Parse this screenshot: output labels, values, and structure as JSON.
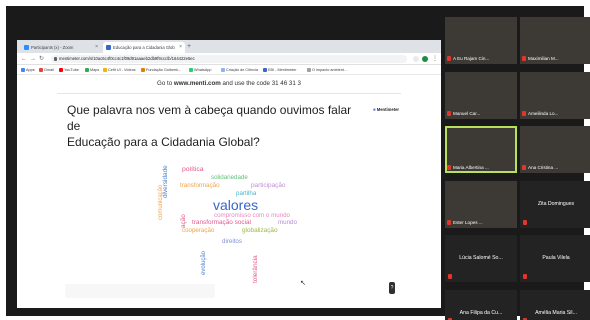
{
  "browser": {
    "tabs": [
      {
        "label": "Participants (x) - Zoom"
      },
      {
        "label": "Educação para a Cidadania Glob"
      }
    ],
    "url": "mentimeter.com/s/10ac6c4f0cc4c1f09d91aaaeb2db9f9ccc/b/164422e5ec",
    "bookmarks": [
      "Apps",
      "Gmail",
      "YouTube",
      "Maps",
      "Cefit UI - Videos",
      "Fundação Gulbenk...",
      "WhatsApp",
      "Criação de Ciência",
      "EBI - Mentimeter",
      "O impacto ambient..."
    ]
  },
  "menti": {
    "goto_prefix": "Go to ",
    "goto_site": "www.menti.com",
    "goto_suffix": " and use the code 31 46 31 3",
    "question_line1": "Que palavra nos vem à cabeça quando ouvimos falar de",
    "question_line2": "Educação para a Cidadania Global?",
    "logo": "Mentimeter"
  },
  "wordcloud": {
    "horizontal": [
      {
        "text": "política",
        "color": "#e0588d"
      },
      {
        "text": "solidariedade",
        "color": "#5fc27a"
      },
      {
        "text": "transformação",
        "color": "#f0a34a"
      },
      {
        "text": "participação",
        "color": "#c58bd6"
      },
      {
        "text": "partilha",
        "color": "#4cb4c7"
      },
      {
        "text": "valores",
        "color": "#3a65c9"
      },
      {
        "text": "compromisso com o mundo",
        "color": "#e58ac0"
      },
      {
        "text": "transformação social",
        "color": "#e0588d"
      },
      {
        "text": "mundo",
        "color": "#b58bd8"
      },
      {
        "text": "cooperação",
        "color": "#f0a34a"
      },
      {
        "text": "globalização",
        "color": "#9ab842"
      },
      {
        "text": "direitos",
        "color": "#7f8fd6"
      }
    ],
    "vertical": [
      {
        "text": "diversidade",
        "color": "#4a7fce"
      },
      {
        "text": "ação",
        "color": "#e0588d"
      },
      {
        "text": "comunicação",
        "color": "#f0a34a"
      },
      {
        "text": "evolução",
        "color": "#4a7fce"
      },
      {
        "text": "tolerância",
        "color": "#e0588d"
      }
    ]
  },
  "participants": [
    {
      "name": "A Eu Rajam Cin...",
      "type": "video"
    },
    {
      "name": "Maximilian M...",
      "type": "video"
    },
    {
      "name": "Manuel Car...",
      "type": "video"
    },
    {
      "name": "Ameilinda Lo...",
      "type": "video"
    },
    {
      "name": "Maria Albertina ...",
      "type": "video",
      "active": true
    },
    {
      "name": "Ana Cristina ...",
      "type": "video"
    },
    {
      "name": "Ester Lopes ...",
      "type": "video"
    },
    {
      "name": "Zita Domingues",
      "type": "name"
    },
    {
      "name": "Lúcia Salomé So...",
      "type": "name"
    },
    {
      "name": "Paula Vilela",
      "type": "name"
    },
    {
      "name": "Ana Filipa da Cu...",
      "type": "name"
    },
    {
      "name": "Amélia Maria Sil...",
      "type": "name"
    }
  ],
  "colors": {
    "frame": "#1a1a1a",
    "active_speaker": "#b9e05a",
    "muted_mic": "#e0362c"
  }
}
